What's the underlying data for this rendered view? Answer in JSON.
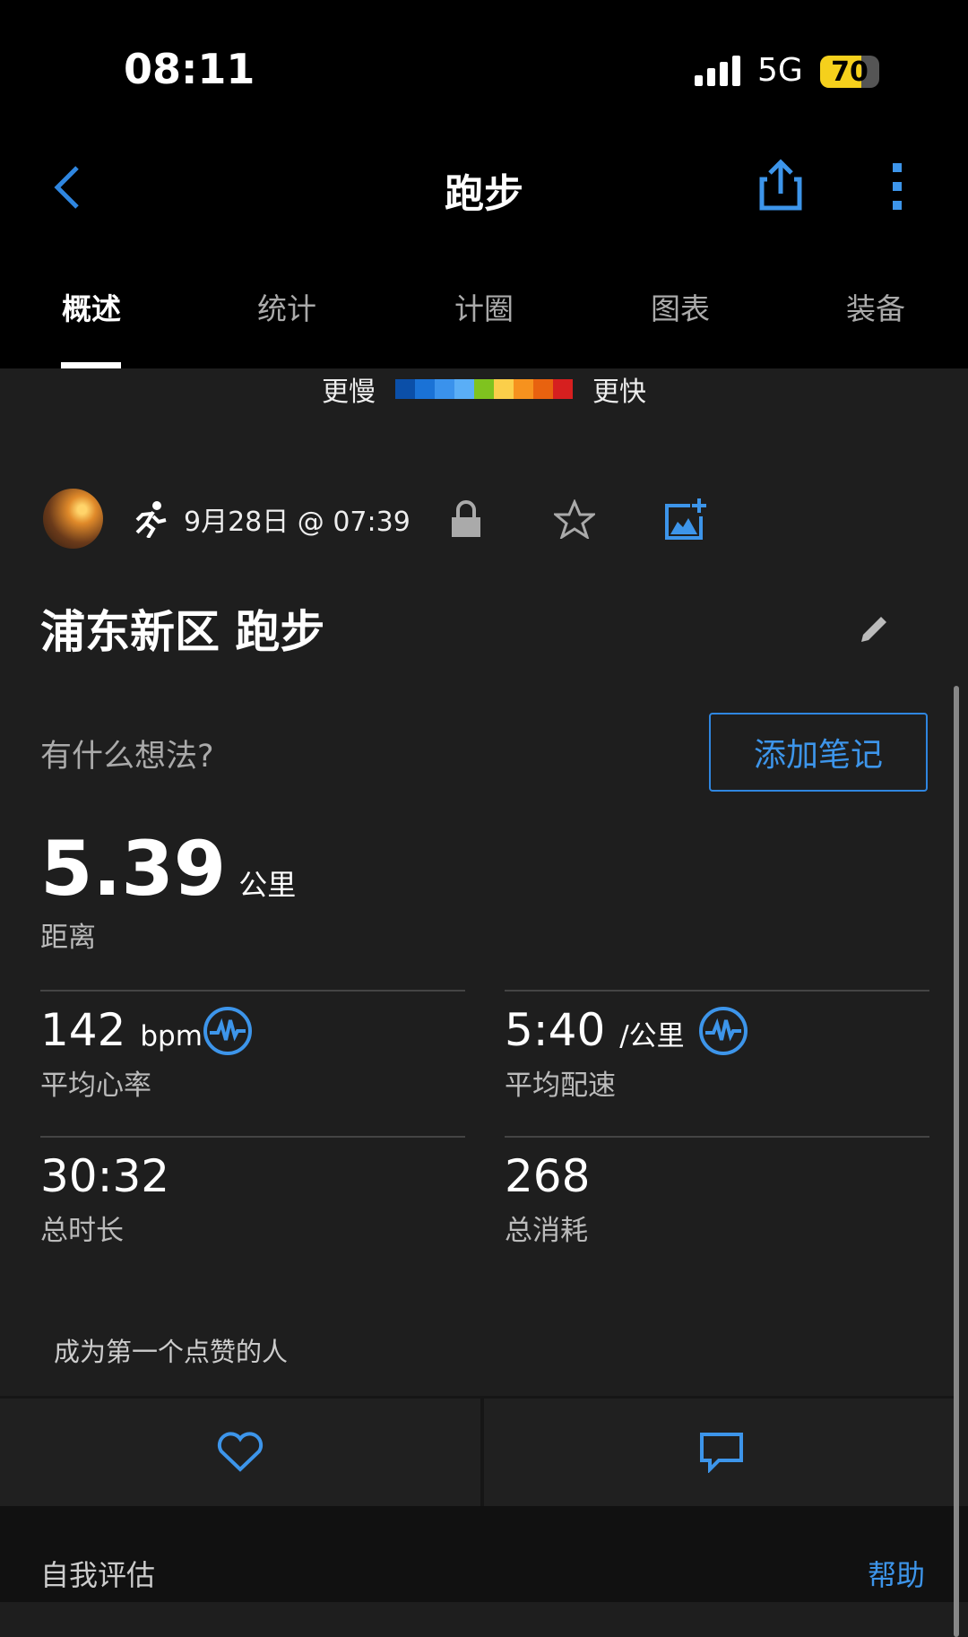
{
  "status_bar": {
    "time": "08:11",
    "network": "5G",
    "battery": "70",
    "battery_level": 70
  },
  "header": {
    "title": "跑步"
  },
  "tabs": [
    {
      "label": "概述",
      "active": true
    },
    {
      "label": "统计"
    },
    {
      "label": "计圈"
    },
    {
      "label": "图表"
    },
    {
      "label": "装备"
    }
  ],
  "legend": {
    "slower": "更慢",
    "faster": "更快",
    "colors": [
      "#0b4fa8",
      "#1a72d6",
      "#3a92ec",
      "#5aaef6",
      "#7fc31f",
      "#fbcf4a",
      "#f6921e",
      "#e8620f",
      "#d61f1f"
    ]
  },
  "activity": {
    "date": "9月28日 @ 07:39",
    "title": "浦东新区 跑步",
    "prompt": "有什么想法?",
    "add_note": "添加笔记"
  },
  "distance": {
    "value": "5.39",
    "unit": "公里",
    "label": "距离"
  },
  "stats": [
    {
      "value": "142",
      "unit": "bpm",
      "label": "平均心率"
    },
    {
      "value": "5:40",
      "unit": "/公里",
      "label": "平均配速"
    },
    {
      "value": "30:32",
      "unit": "",
      "label": "总时长"
    },
    {
      "value": "268",
      "unit": "",
      "label": "总消耗"
    }
  ],
  "likes_text": "成为第一个点赞的人",
  "self_eval": {
    "title": "自我评估",
    "help": "帮助"
  },
  "accent": "#3d95ea"
}
